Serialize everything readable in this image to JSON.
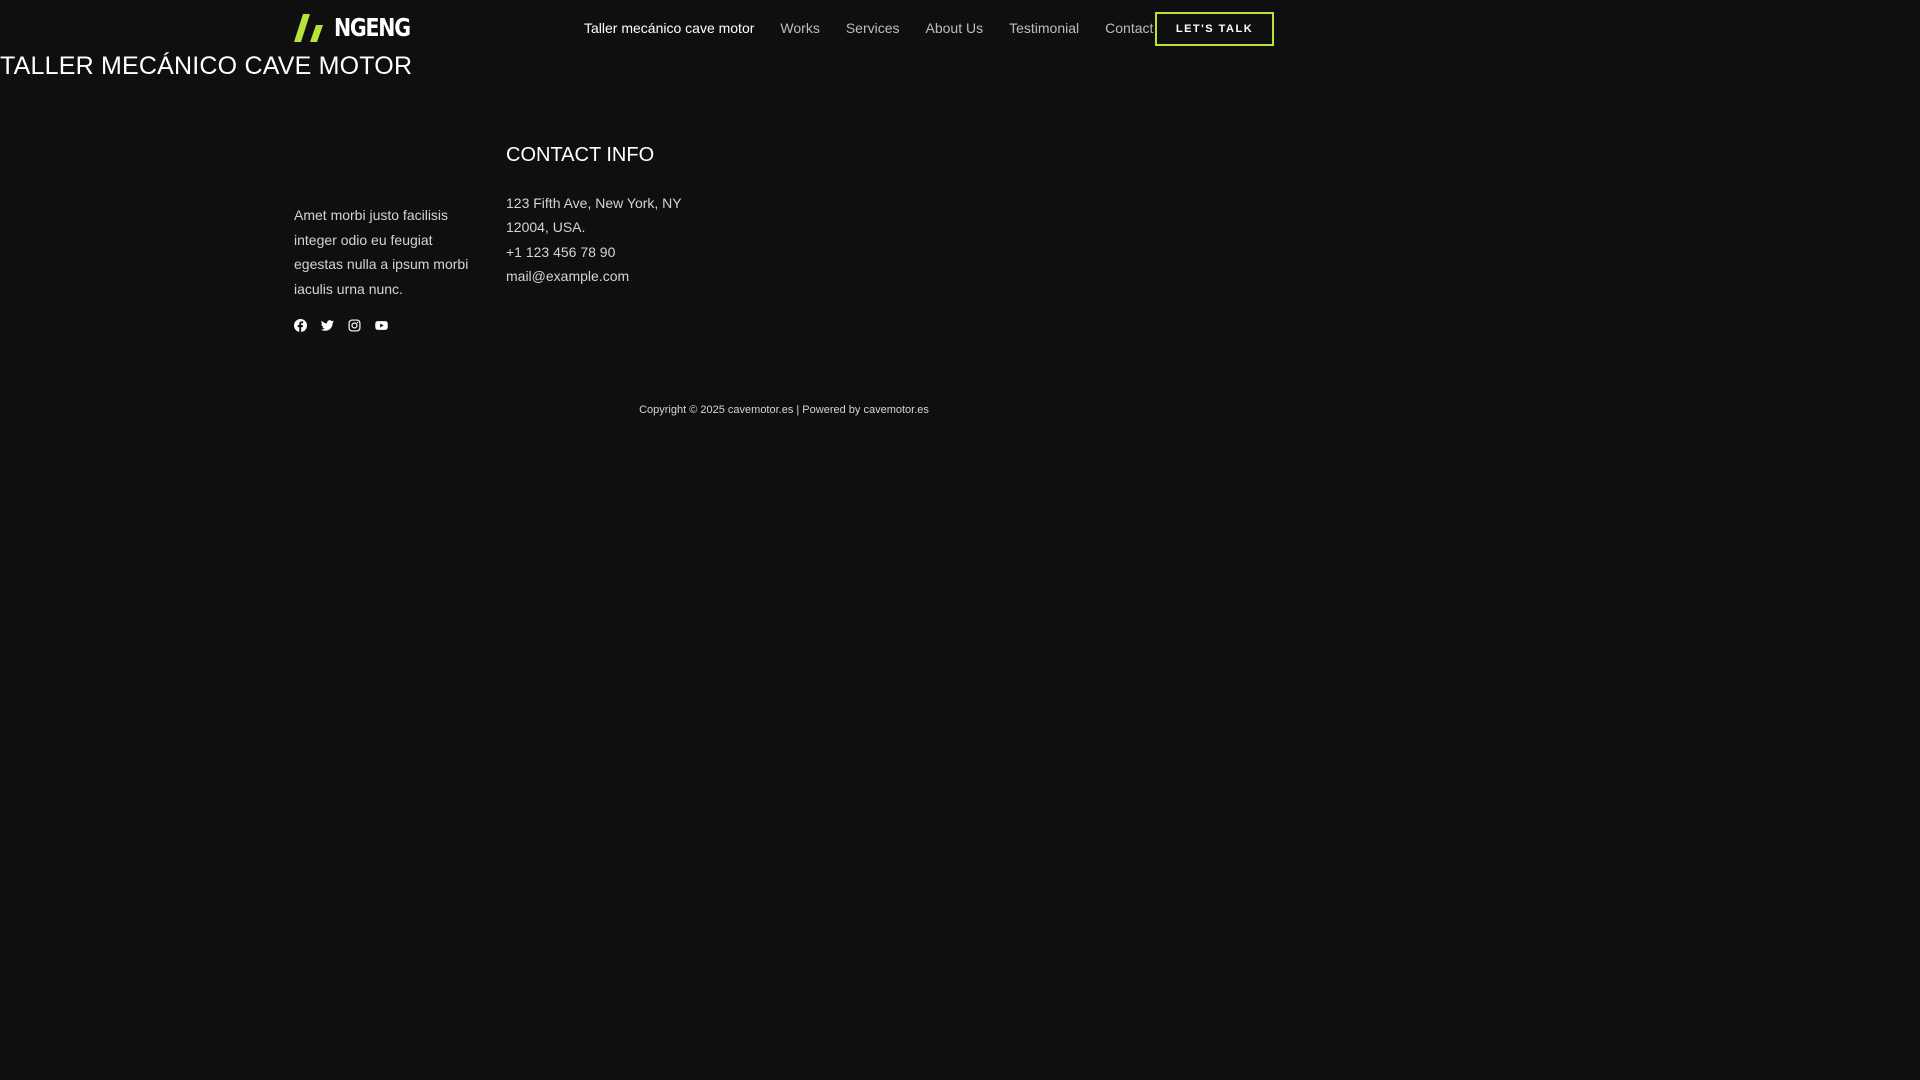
{
  "header": {
    "logo_text": "NGENG",
    "nav": [
      {
        "label": "Taller mecánico cave motor",
        "active": true
      },
      {
        "label": "Works"
      },
      {
        "label": "Services"
      },
      {
        "label": "About Us"
      },
      {
        "label": "Testimonial"
      },
      {
        "label": "Contact"
      }
    ],
    "cta_label": "LET'S TALK"
  },
  "page": {
    "title": "TALLER MECÁNICO CAVE MOTOR"
  },
  "footer": {
    "about_text": "Amet morbi justo facilisis integer odio eu feugiat egestas nulla a ipsum morbi iaculis urna nunc.",
    "social": [
      "facebook-icon",
      "twitter-icon",
      "instagram-icon",
      "youtube-icon"
    ],
    "contact_heading": "CONTACT INFO",
    "address_line1": "123 Fifth Ave, New York, NY",
    "address_line2": "12004, USA.",
    "phone": "+1 123 456 78 90",
    "email": "mail@example.com",
    "copyright_prefix": "Copyright © 2025 cavemotor.es | Powered by",
    "powered_by": "cavemotor.es"
  },
  "colors": {
    "background": "#0f0f0f",
    "accent": "#b6e23a",
    "text": "#ffffff",
    "muted_text": "#d4d4d4"
  }
}
